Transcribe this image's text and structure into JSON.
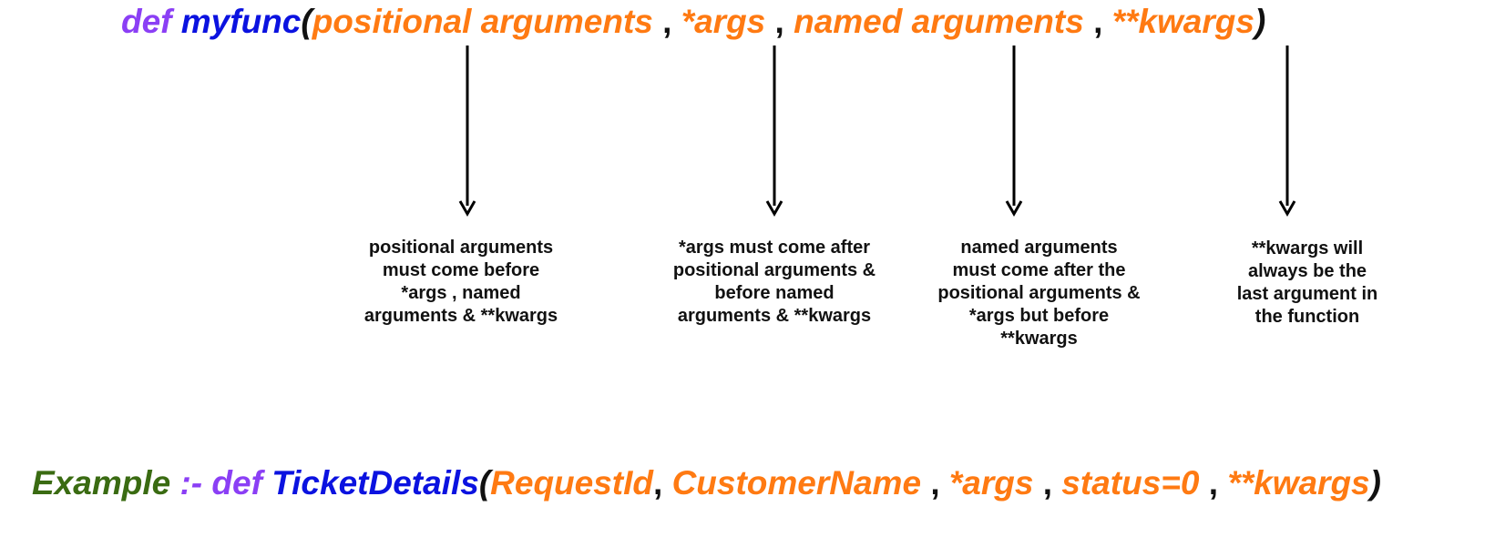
{
  "signature": {
    "def": "def",
    "func": "myfunc",
    "open": "(",
    "p1": "positional arguments",
    "sep": ",",
    "p2": "*args",
    "p3": "named arguments",
    "p4": "**kwargs",
    "close": ")"
  },
  "notes": [
    "positional arguments must come before *args , named arguments & **kwargs",
    "*args must come after positional arguments & before named arguments & **kwargs",
    "named arguments must come after the positional arguments & *args but before **kwargs",
    "**kwargs will always be the last argument in the function"
  ],
  "example": {
    "label": "Example",
    "separator": ":-",
    "def": "def",
    "func": "TicketDetails",
    "open": "(",
    "a1": "RequestId",
    "comma": ",",
    "a2": "CustomerName",
    "sep": ",",
    "a3": "*args",
    "a4": "status=0",
    "a5": "**kwargs",
    "close": ")"
  },
  "colors": {
    "keyword": "#8b3ff5",
    "function_name": "#0b12e0",
    "argument": "#ff7a12",
    "example_label": "#3a6b12",
    "text": "#111111"
  }
}
